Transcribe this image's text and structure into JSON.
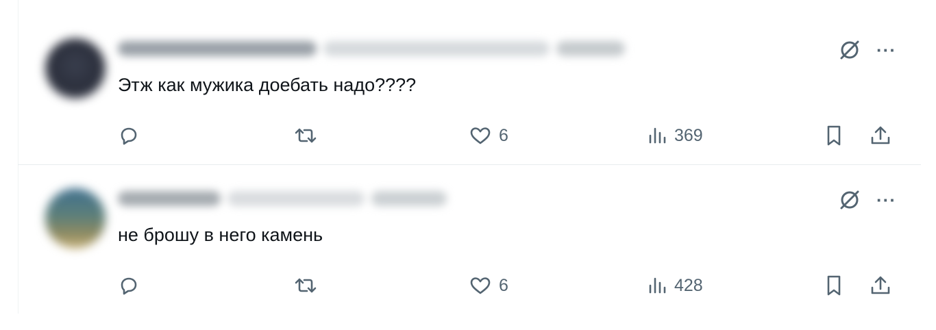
{
  "posts": [
    {
      "text": "Этж как мужика доебать надо????",
      "likes": "6",
      "views": "369"
    },
    {
      "text": "не брошу в него камень",
      "likes": "6",
      "views": "428"
    }
  ],
  "colors": {
    "text": "#0f1419",
    "muted": "#536471",
    "divider": "#e7ecee"
  },
  "icons": {
    "grok": "slashed-circle-icon",
    "more": "more-horizontal-icon",
    "reply": "reply-icon",
    "repost": "repost-icon",
    "like": "heart-icon",
    "views": "bar-chart-icon",
    "bookmark": "bookmark-icon",
    "share": "share-icon"
  }
}
